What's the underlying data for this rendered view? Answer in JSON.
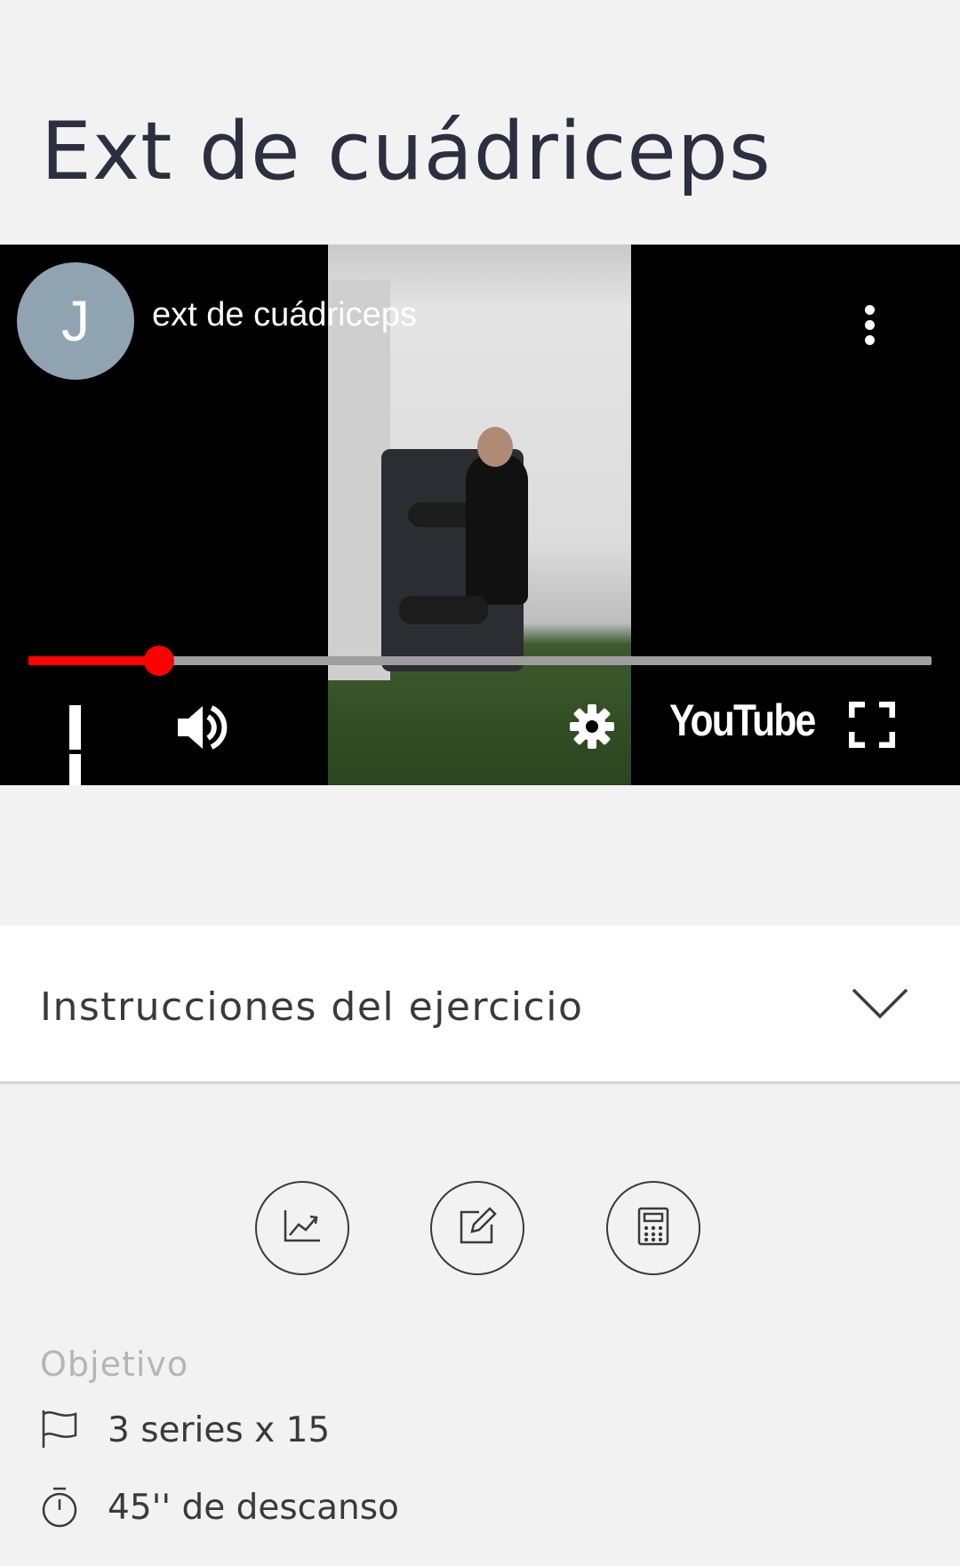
{
  "exercise": {
    "title": "Ext de cuádriceps"
  },
  "video": {
    "channel_initial": "J",
    "title": "ext de cuádriceps",
    "progress_fraction": 0.145,
    "brand": "YouTube",
    "colors": {
      "progress": "#ff0000",
      "avatar": "#8fa4b0"
    }
  },
  "accordion": {
    "label": "Instrucciones del ejercicio"
  },
  "actions": [
    {
      "icon": "chart-line-icon"
    },
    {
      "icon": "edit-icon"
    },
    {
      "icon": "calculator-icon"
    }
  ],
  "objective": {
    "heading": "Objetivo",
    "series": "3 series x 15",
    "rest": "45'' de descanso"
  }
}
